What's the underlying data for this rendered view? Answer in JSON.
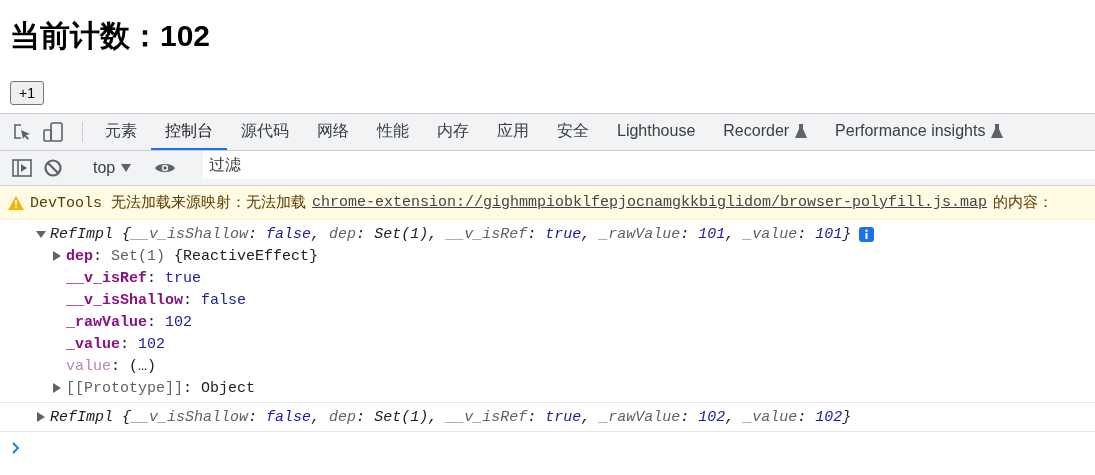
{
  "page": {
    "heading": "当前计数：102",
    "button": "+1"
  },
  "devtools": {
    "tabs": [
      {
        "label": "元素",
        "selected": false,
        "experimental": false
      },
      {
        "label": "控制台",
        "selected": true,
        "experimental": false
      },
      {
        "label": "源代码",
        "selected": false,
        "experimental": false
      },
      {
        "label": "网络",
        "selected": false,
        "experimental": false
      },
      {
        "label": "性能",
        "selected": false,
        "experimental": false
      },
      {
        "label": "内存",
        "selected": false,
        "experimental": false
      },
      {
        "label": "应用",
        "selected": false,
        "experimental": false
      },
      {
        "label": "安全",
        "selected": false,
        "experimental": false
      },
      {
        "label": "Lighthouse",
        "selected": false,
        "experimental": false
      },
      {
        "label": "Recorder",
        "selected": false,
        "experimental": true
      },
      {
        "label": "Performance insights",
        "selected": false,
        "experimental": true
      }
    ],
    "toolbar": {
      "context": "top",
      "filter_placeholder": "过滤"
    },
    "warning": {
      "text": "DevTools 无法加载来源映射：无法加载",
      "link": "chrome-extension://gighmmpiobklfepjocnamgkkbiglidom/browser-polyfill.js.map",
      "suffix": "的内容："
    },
    "entries": [
      {
        "expanded": true,
        "info_badge": true,
        "preview": [
          {
            "text": "RefImpl {",
            "kind": "plain"
          },
          {
            "text": "__v_isShallow",
            "kind": "key"
          },
          {
            "text": ": ",
            "kind": "plain"
          },
          {
            "text": "false",
            "kind": "literal"
          },
          {
            "text": ", ",
            "kind": "plain"
          },
          {
            "text": "dep",
            "kind": "key"
          },
          {
            "text": ": ",
            "kind": "plain"
          },
          {
            "text": "Set(1)",
            "kind": "plain"
          },
          {
            "text": ", ",
            "kind": "plain"
          },
          {
            "text": "__v_isRef",
            "kind": "key"
          },
          {
            "text": ": ",
            "kind": "plain"
          },
          {
            "text": "true",
            "kind": "literal"
          },
          {
            "text": ", ",
            "kind": "plain"
          },
          {
            "text": "_rawValue",
            "kind": "key"
          },
          {
            "text": ": ",
            "kind": "plain"
          },
          {
            "text": "101",
            "kind": "literal"
          },
          {
            "text": ", ",
            "kind": "plain"
          },
          {
            "text": "_value",
            "kind": "key"
          },
          {
            "text": ": ",
            "kind": "plain"
          },
          {
            "text": "101",
            "kind": "literal"
          },
          {
            "text": "}",
            "kind": "plain"
          }
        ],
        "properties": [
          {
            "expandable": true,
            "tokens": [
              {
                "text": "dep",
                "kind": "own"
              },
              {
                "text": ": ",
                "kind": "plain"
              },
              {
                "text": "Set(1)",
                "kind": "meta"
              },
              {
                "text": " {ReactiveEffect}",
                "kind": "plain"
              }
            ]
          },
          {
            "expandable": false,
            "tokens": [
              {
                "text": "__v_isRef",
                "kind": "own"
              },
              {
                "text": ": ",
                "kind": "plain"
              },
              {
                "text": "true",
                "kind": "literal"
              }
            ]
          },
          {
            "expandable": false,
            "tokens": [
              {
                "text": "__v_isShallow",
                "kind": "own"
              },
              {
                "text": ": ",
                "kind": "plain"
              },
              {
                "text": "false",
                "kind": "literal"
              }
            ]
          },
          {
            "expandable": false,
            "tokens": [
              {
                "text": "_rawValue",
                "kind": "own"
              },
              {
                "text": ": ",
                "kind": "plain"
              },
              {
                "text": "102",
                "kind": "literal"
              }
            ]
          },
          {
            "expandable": false,
            "tokens": [
              {
                "text": "_value",
                "kind": "own"
              },
              {
                "text": ": ",
                "kind": "plain"
              },
              {
                "text": "102",
                "kind": "literal"
              }
            ]
          },
          {
            "expandable": false,
            "tokens": [
              {
                "text": "value",
                "kind": "accessor"
              },
              {
                "text": ": ",
                "kind": "plain"
              },
              {
                "text": "(…)",
                "kind": "plain"
              }
            ]
          },
          {
            "expandable": true,
            "tokens": [
              {
                "text": "[[Prototype]]",
                "kind": "internal"
              },
              {
                "text": ": ",
                "kind": "plain"
              },
              {
                "text": "Object",
                "kind": "plain"
              }
            ]
          }
        ]
      },
      {
        "expanded": false,
        "info_badge": false,
        "preview": [
          {
            "text": "RefImpl {",
            "kind": "plain"
          },
          {
            "text": "__v_isShallow",
            "kind": "key"
          },
          {
            "text": ": ",
            "kind": "plain"
          },
          {
            "text": "false",
            "kind": "literal"
          },
          {
            "text": ", ",
            "kind": "plain"
          },
          {
            "text": "dep",
            "kind": "key"
          },
          {
            "text": ": ",
            "kind": "plain"
          },
          {
            "text": "Set(1)",
            "kind": "plain"
          },
          {
            "text": ", ",
            "kind": "plain"
          },
          {
            "text": "__v_isRef",
            "kind": "key"
          },
          {
            "text": ": ",
            "kind": "plain"
          },
          {
            "text": "true",
            "kind": "literal"
          },
          {
            "text": ", ",
            "kind": "plain"
          },
          {
            "text": "_rawValue",
            "kind": "key"
          },
          {
            "text": ": ",
            "kind": "plain"
          },
          {
            "text": "102",
            "kind": "literal"
          },
          {
            "text": ", ",
            "kind": "plain"
          },
          {
            "text": "_value",
            "kind": "key"
          },
          {
            "text": ": ",
            "kind": "plain"
          },
          {
            "text": "102",
            "kind": "literal"
          },
          {
            "text": "}",
            "kind": "plain"
          }
        ]
      }
    ]
  }
}
